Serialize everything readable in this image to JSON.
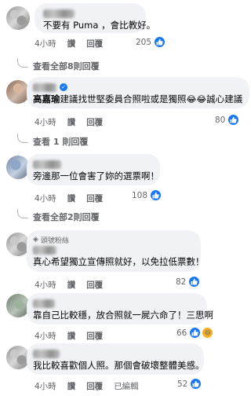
{
  "comments": [
    {
      "text": "不要有 Puma ，會比教好。",
      "time": "4小時",
      "like": "讚",
      "reply": "回覆",
      "reaction_count": "205",
      "reactions": [
        "like"
      ]
    },
    {
      "author": "高嘉瑜",
      "text_after_author": "建議找世堅委員合照啦或是獨照",
      "text_tail": "誠心建議",
      "time": "4小時",
      "like": "讚",
      "reply": "回覆",
      "reaction_count": "80",
      "reactions": [
        "like"
      ]
    },
    {
      "text": "旁邊那一位會害了妳的選票啊！",
      "time": "4小時",
      "like": "讚",
      "reply": "回覆",
      "reaction_count": "108",
      "reactions": [
        "like"
      ]
    },
    {
      "badge": "頭號粉絲",
      "text": "真心希望獨立宣傳照就好，以免拉低票數！",
      "time": "4小時",
      "like": "讚",
      "reply": "回覆",
      "reaction_count": "82",
      "reactions": [
        "like"
      ]
    },
    {
      "text": "靠自己比較穩，放合照就一屍六命了！三思啊",
      "time": "4小時",
      "like": "讚",
      "reply": "回覆",
      "reaction_count": "66",
      "reactions": [
        "like",
        "haha"
      ]
    },
    {
      "text": "我比較喜歡個人照。那個會破壞整體美感。",
      "time": "4小時",
      "like": "讚",
      "reply": "回覆",
      "edited": "已編輯",
      "reaction_count": "52",
      "reactions": [
        "like"
      ]
    }
  ],
  "reply_links": [
    "查看全部8則回覆",
    "查看 1 則回覆",
    "查看全部2則回覆"
  ],
  "colors": {
    "bubble": "#f0f2f5",
    "like_blue": "#1877f2",
    "meta_gray": "#65676b"
  }
}
